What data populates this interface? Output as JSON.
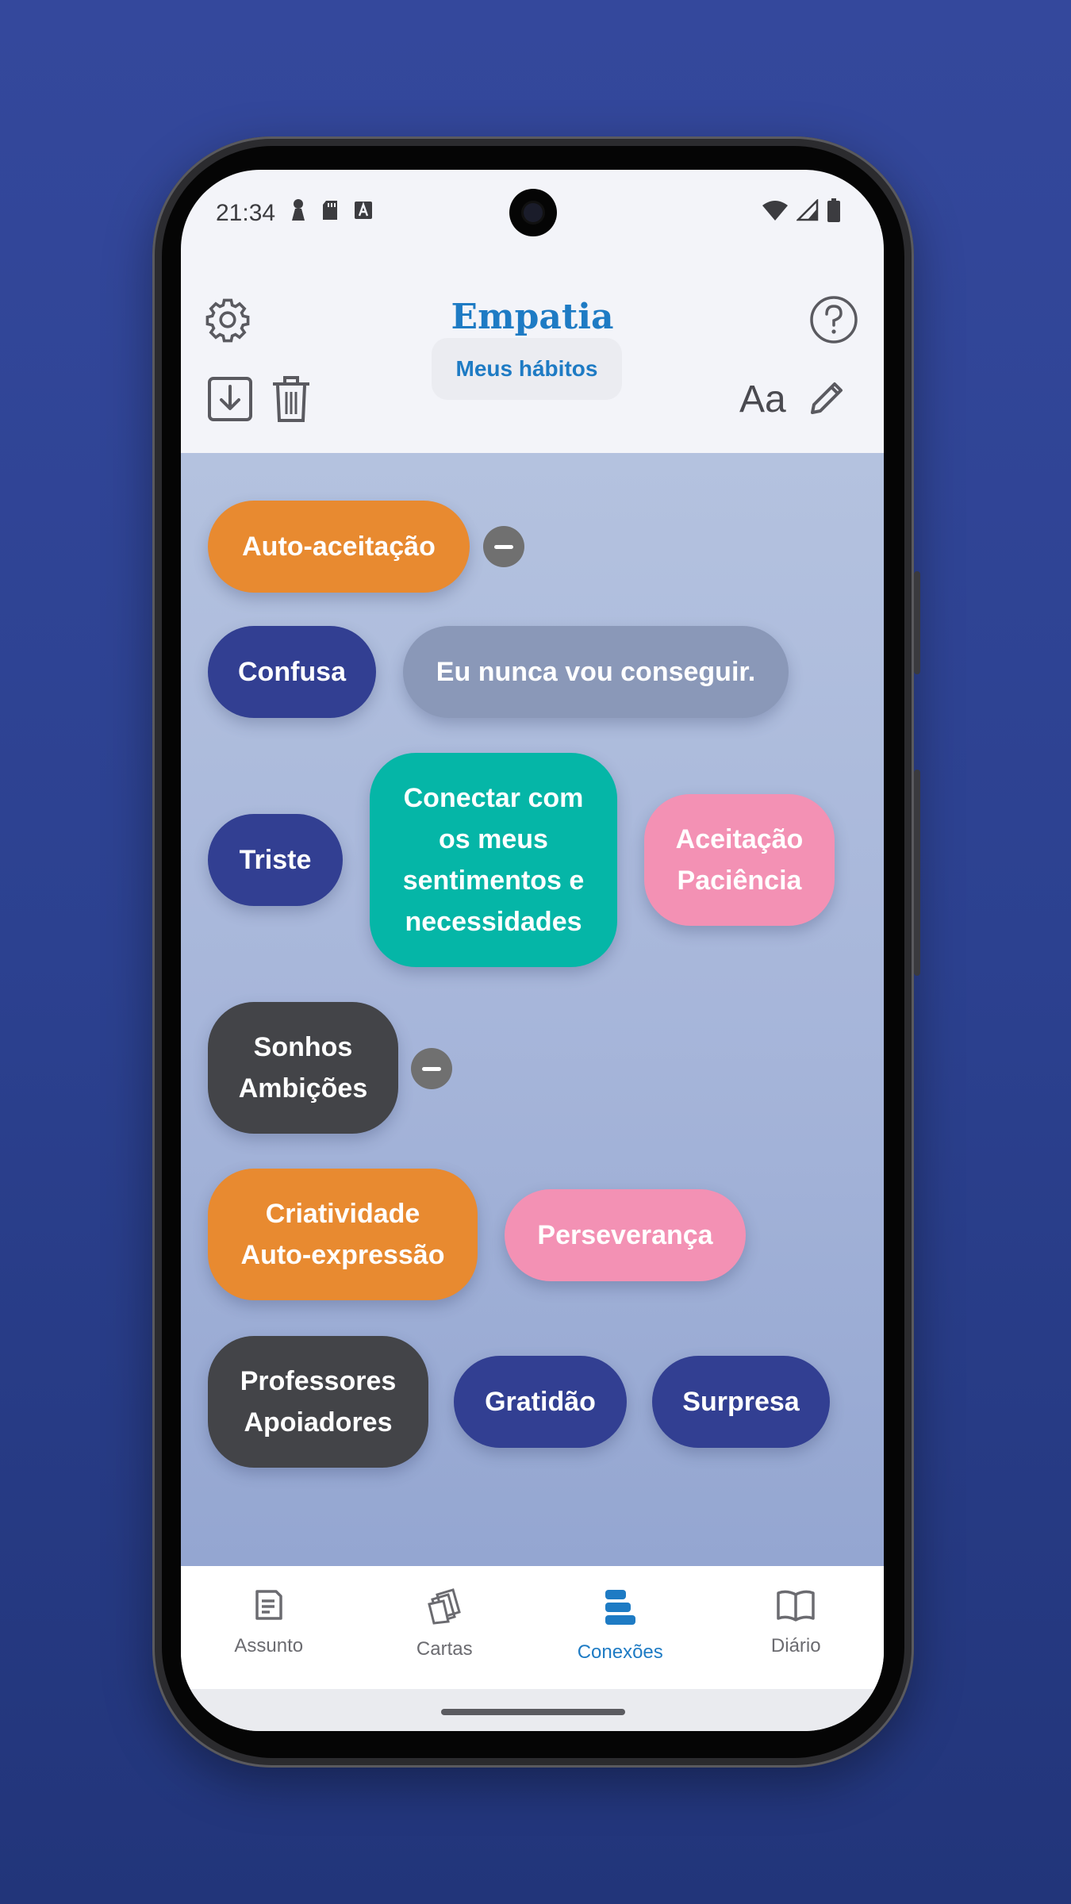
{
  "status_bar": {
    "time": "21:34"
  },
  "header": {
    "title": "Empatia"
  },
  "toolbar": {
    "habits_label": "Meus hábitos",
    "font_label": "Aa"
  },
  "bubbles": {
    "b1": "Auto-aceitação",
    "b2": "Confusa",
    "b3": "Eu nunca vou conseguir.",
    "b4": "Triste",
    "b5_lines": [
      "Conectar com",
      "os meus",
      "sentimentos e",
      "necessidades"
    ],
    "b6_lines": [
      "Aceitação",
      "Paciência"
    ],
    "b7_lines": [
      "Sonhos",
      "Ambições"
    ],
    "b8_lines": [
      "Criatividade",
      "Auto-expressão"
    ],
    "b9": "Perseverança",
    "b10_lines": [
      "Professores",
      "Apoiadores"
    ],
    "b11": "Gratidão",
    "b12": "Surpresa"
  },
  "nav": {
    "items": [
      {
        "label": "Assunto",
        "icon": "document-icon",
        "active": false
      },
      {
        "label": "Cartas",
        "icon": "cards-icon",
        "active": false
      },
      {
        "label": "Conexões",
        "icon": "stack-icon",
        "active": true
      },
      {
        "label": "Diário",
        "icon": "book-icon",
        "active": false
      }
    ]
  },
  "colors": {
    "accent": "#1e7bc4",
    "orange": "#e88a30",
    "navy": "#323f92",
    "teal": "#05b6a7",
    "pink": "#f391b4",
    "dark": "#434448",
    "muted": "#8a98b8"
  }
}
